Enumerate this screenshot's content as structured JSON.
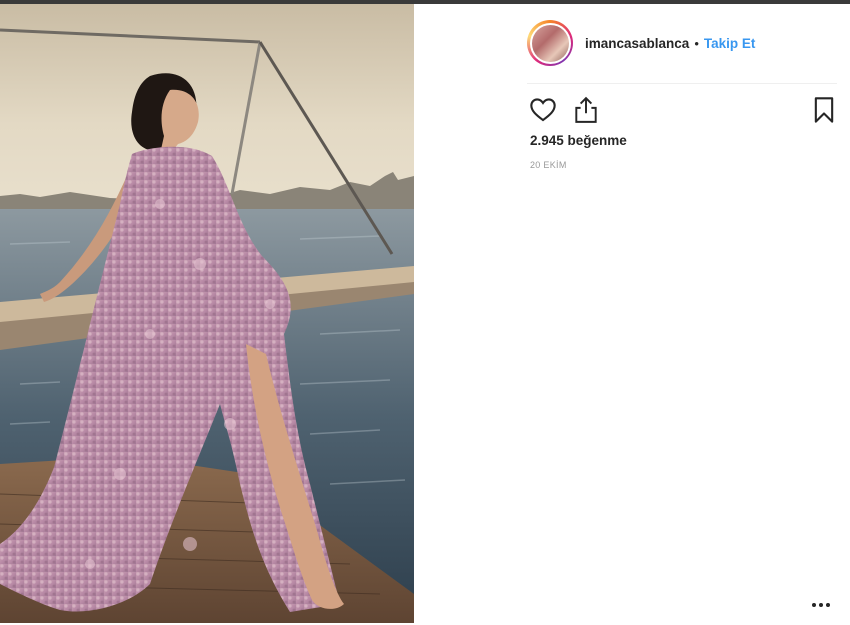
{
  "post": {
    "username": "imancasablanca",
    "separator": "•",
    "follow_label": "Takip Et",
    "likes_text": "2.945 beğenme",
    "date_text": "20 EKİM"
  },
  "icons": {
    "like": "heart-icon",
    "share": "share-icon",
    "save": "bookmark-icon",
    "more": "more-options-icon"
  },
  "colors": {
    "follow": "#3897f0",
    "text": "#262626",
    "muted": "#999999"
  }
}
